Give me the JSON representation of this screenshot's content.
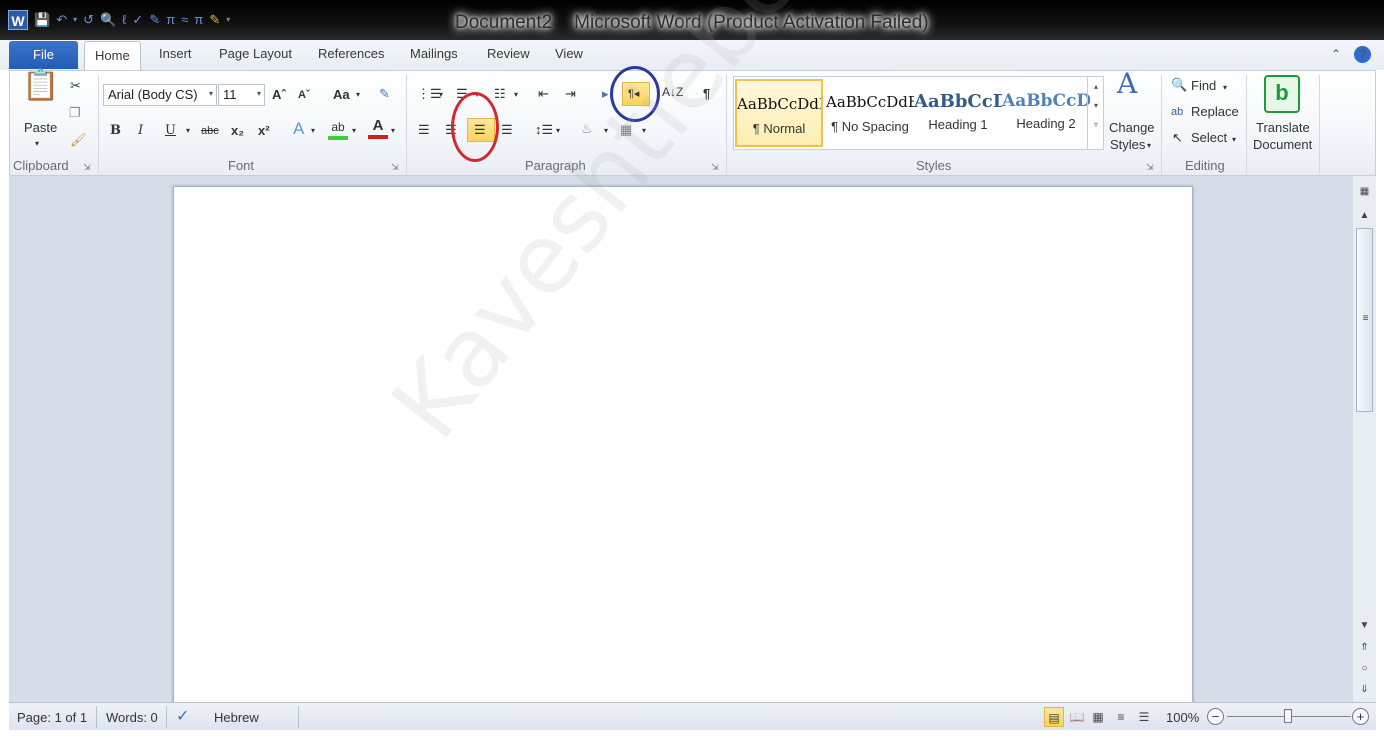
{
  "window": {
    "doc_name": "Document2",
    "app_title": "Microsoft Word (Product Activation Failed)",
    "word_logo": "W"
  },
  "quick_access": [
    "save-icon",
    "undo-icon",
    "redo-icon",
    "print-preview-icon",
    "spell-icon",
    "format-icon",
    "pi-icon",
    "approx-icon",
    "pi-icon",
    "highlight-icon",
    "customize-icon"
  ],
  "tabs": {
    "file": "File",
    "items": [
      "Home",
      "Insert",
      "Page Layout",
      "References",
      "Mailings",
      "Review",
      "View"
    ],
    "active": "Home"
  },
  "clipboard": {
    "paste": "Paste",
    "label": "Clipboard"
  },
  "font": {
    "name": "Arial (Body CS)",
    "size": "11",
    "label": "Font",
    "grow": "Aˆ",
    "shrink": "Aˇ",
    "change_case": "Aa",
    "bold": "B",
    "italic": "I",
    "underline": "U",
    "strike": "abc",
    "subscript": "x₂",
    "superscript": "x²",
    "text_effect": "A",
    "highlight": "ab",
    "font_color": "A",
    "highlight_color": "#3ccf3c",
    "font_color_value": "#d02020"
  },
  "paragraph": {
    "label": "Paragraph",
    "pilcrow": "¶",
    "rtl": "¶◂"
  },
  "styles": {
    "label": "Styles",
    "items": [
      {
        "preview": "AaBbCcDdEe",
        "name": "¶ Normal"
      },
      {
        "preview": "AaBbCcDdEe",
        "name": "¶ No Spacing"
      },
      {
        "preview": "AaBbCcDdEe",
        "name": "Heading 1"
      },
      {
        "preview": "AaBbCcDdEe",
        "name": "Heading 2"
      }
    ],
    "change_line1": "Change",
    "change_line2": "Styles"
  },
  "editing": {
    "label": "Editing",
    "find": "Find",
    "replace": "Replace",
    "select": "Select"
  },
  "translate": {
    "line1": "Translate",
    "line2": "Document"
  },
  "watermark": "Kaveshtiebel.com",
  "status": {
    "page": "Page: 1 of 1",
    "words": "Words: 0",
    "language": "Hebrew",
    "zoom": "100%"
  },
  "annotations": {
    "red_circle_color": "#d4282e",
    "blue_circle_color": "#2b3a9c"
  }
}
